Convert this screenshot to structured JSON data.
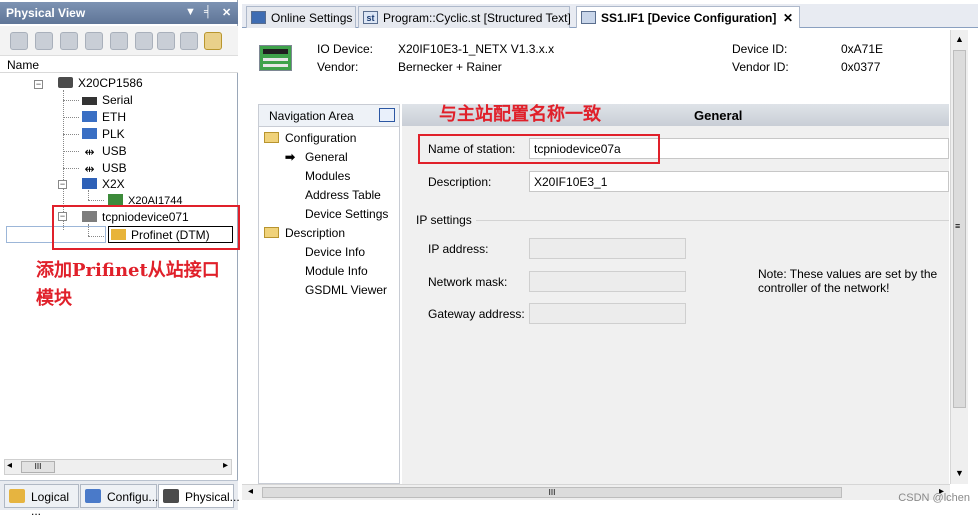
{
  "left_panel": {
    "title": "Physical View",
    "pin_controls": "▼ ᚚ ✕",
    "name_header": "Name",
    "tree": [
      {
        "label": "X20CP1586"
      },
      {
        "label": "Serial"
      },
      {
        "label": "ETH"
      },
      {
        "label": "PLK"
      },
      {
        "label": "USB"
      },
      {
        "label": "USB"
      },
      {
        "label": "X2X"
      },
      {
        "label": "X20AI1744"
      },
      {
        "label": "tcpniodevice071"
      },
      {
        "label": "Profinet (DTM)"
      }
    ],
    "annotation": "添加Prifinet从站接口模块",
    "scroll_grip": "III",
    "bottom_tabs": [
      "Logical ...",
      "Configu...",
      "Physical..."
    ]
  },
  "doc_tabs": [
    {
      "label": "Online Settings",
      "icon": ""
    },
    {
      "label": "Program::Cyclic.st [Structured Text]",
      "icon": "st"
    },
    {
      "label": "SS1.IF1 [Device Configuration]",
      "icon": "",
      "close": "✕"
    }
  ],
  "device_header": {
    "io_device_label": "IO Device:",
    "io_device_value": "X20IF10E3-1_NETX V1.3.x.x",
    "vendor_label": "Vendor:",
    "vendor_value": "Bernecker + Rainer",
    "device_id_label": "Device ID:",
    "device_id_value": "0xA71E",
    "vendor_id_label": "Vendor ID:",
    "vendor_id_value": "0x0377"
  },
  "navigation": {
    "title": "Navigation Area",
    "items": [
      {
        "label": "Configuration"
      },
      {
        "label": "General",
        "selected": true
      },
      {
        "label": "Modules"
      },
      {
        "label": "Address Table"
      },
      {
        "label": "Device Settings"
      },
      {
        "label": "Description"
      },
      {
        "label": "Device Info"
      },
      {
        "label": "Module Info"
      },
      {
        "label": "GSDML Viewer"
      }
    ]
  },
  "general": {
    "section_title": "General",
    "annotation": "与主站配置名称一致",
    "name_of_station_label": "Name of station:",
    "name_of_station_value": "tcpniodevice07a",
    "description_label": "Description:",
    "description_value": "X20IF10E3_1",
    "ip_settings_label": "IP settings",
    "ip_address_label": "IP address:",
    "network_mask_label": "Network mask:",
    "gateway_label": "Gateway address:",
    "note": "Note: These values are set by the controller of the network!"
  },
  "hscroll_grip": "III",
  "watermark": "CSDN @lchen",
  "colors": {
    "annotation_red": "#e0202a",
    "title_bar": "#6b82a6"
  }
}
